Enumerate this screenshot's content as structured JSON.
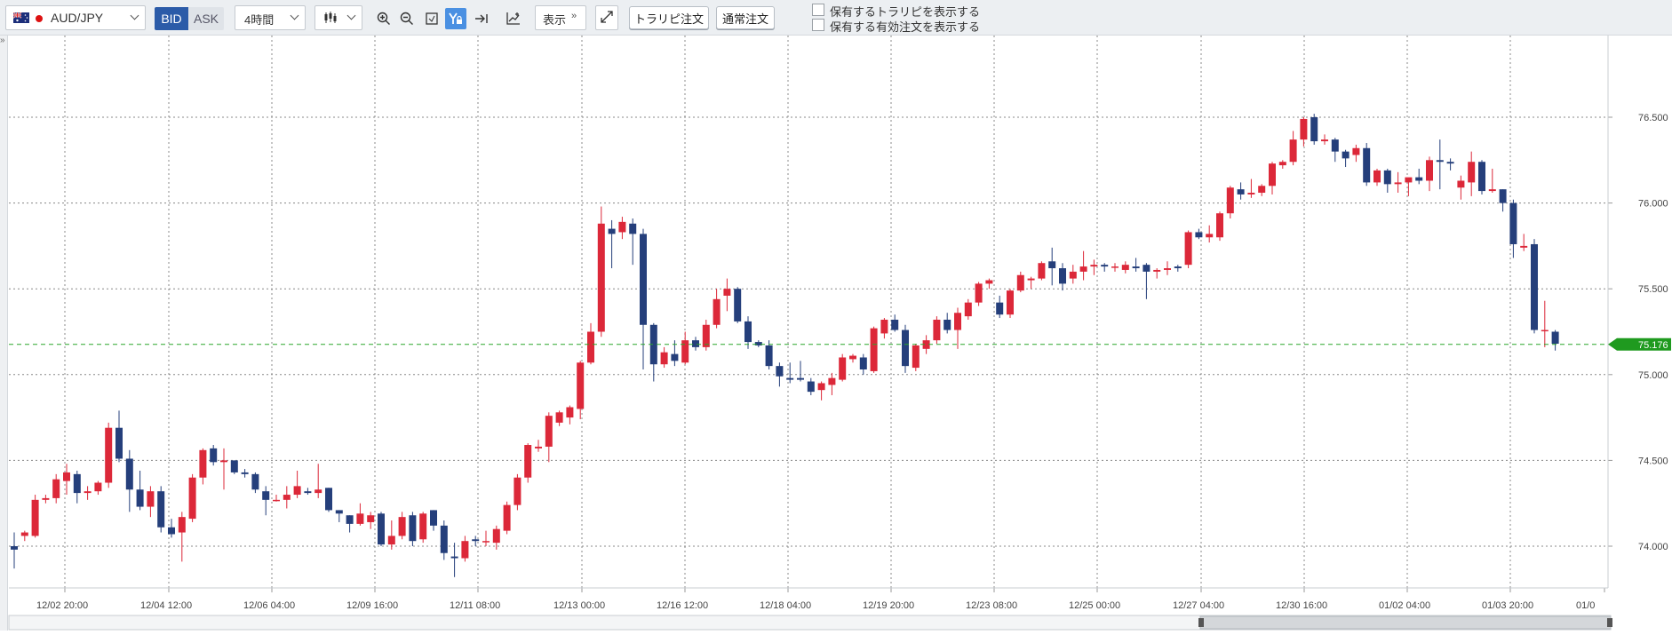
{
  "toolbar": {
    "pair": "AUD/JPY",
    "bid_label": "BID",
    "ask_label": "ASK",
    "timeframe": "4時間",
    "display_label": "表示",
    "trailing_order_label": "トラリピ注文",
    "normal_order_label": "通常注文",
    "checkbox_show_positions": "保有するトラリピを表示する",
    "checkbox_show_orders": "保有する有効注文を表示する",
    "left_expander": "»"
  },
  "chart_data": {
    "type": "candlestick",
    "symbol": "AUD/JPY",
    "interval": "4時間",
    "price": "BID",
    "colors": {
      "up": "#dc2839",
      "down": "#253f7b",
      "current_line": "#2aa52a",
      "grid": "#888888"
    },
    "ylim": [
      73.63,
      76.75
    ],
    "y_ticks": [
      "76.500",
      "76.000",
      "75.500",
      "75.000",
      "74.500",
      "74.000"
    ],
    "x_ticks": [
      "12/02 20:00",
      "12/04 12:00",
      "12/06 04:00",
      "12/09 16:00",
      "12/11 08:00",
      "12/13 00:00",
      "12/16 12:00",
      "12/18 04:00",
      "12/19 20:00",
      "12/23 08:00",
      "12/25 00:00",
      "12/27 04:00",
      "12/30 16:00",
      "01/02 04:00",
      "01/03 20:00",
      "01/0"
    ],
    "current_price": "75.176",
    "candles": [
      [
        74.0,
        74.08,
        73.87,
        73.98
      ],
      [
        74.06,
        74.09,
        74.03,
        74.08
      ],
      [
        74.06,
        74.3,
        74.05,
        74.27
      ],
      [
        74.27,
        74.3,
        74.25,
        74.28
      ],
      [
        74.28,
        74.42,
        74.25,
        74.39
      ],
      [
        74.38,
        74.48,
        74.3,
        74.43
      ],
      [
        74.42,
        74.44,
        74.25,
        74.31
      ],
      [
        74.31,
        74.35,
        74.27,
        74.32
      ],
      [
        74.32,
        74.38,
        74.3,
        74.37
      ],
      [
        74.37,
        74.72,
        74.34,
        74.69
      ],
      [
        74.69,
        74.79,
        74.49,
        74.51
      ],
      [
        74.51,
        74.56,
        74.2,
        74.33
      ],
      [
        74.33,
        74.44,
        74.21,
        74.23
      ],
      [
        74.23,
        74.35,
        74.17,
        74.32
      ],
      [
        74.32,
        74.35,
        74.08,
        74.11
      ],
      [
        74.11,
        74.16,
        74.05,
        74.07
      ],
      [
        74.08,
        74.2,
        73.91,
        74.17
      ],
      [
        74.16,
        74.42,
        74.14,
        74.4
      ],
      [
        74.4,
        74.57,
        74.36,
        74.56
      ],
      [
        74.57,
        74.59,
        74.47,
        74.49
      ],
      [
        74.49,
        74.57,
        74.33,
        74.5
      ],
      [
        74.5,
        74.5,
        74.42,
        74.43
      ],
      [
        74.43,
        74.45,
        74.4,
        74.42
      ],
      [
        74.42,
        74.43,
        74.31,
        74.33
      ],
      [
        74.32,
        74.35,
        74.18,
        74.27
      ],
      [
        74.27,
        74.3,
        74.26,
        74.27
      ],
      [
        74.27,
        74.35,
        74.22,
        74.3
      ],
      [
        74.3,
        74.44,
        74.28,
        74.35
      ],
      [
        74.32,
        74.34,
        74.3,
        74.31
      ],
      [
        74.31,
        74.48,
        74.28,
        74.33
      ],
      [
        74.34,
        74.34,
        74.2,
        74.21
      ],
      [
        74.21,
        74.21,
        74.14,
        74.19
      ],
      [
        74.18,
        74.18,
        74.08,
        74.13
      ],
      [
        74.13,
        74.25,
        74.12,
        74.19
      ],
      [
        74.14,
        74.2,
        74.1,
        74.18
      ],
      [
        74.19,
        74.2,
        74.0,
        74.01
      ],
      [
        74.01,
        74.15,
        73.98,
        74.06
      ],
      [
        74.06,
        74.2,
        74.04,
        74.17
      ],
      [
        74.18,
        74.2,
        74.0,
        74.03
      ],
      [
        74.04,
        74.2,
        74.02,
        74.19
      ],
      [
        74.21,
        74.21,
        74.09,
        74.12
      ],
      [
        74.12,
        74.15,
        73.92,
        73.96
      ],
      [
        73.94,
        74.02,
        73.82,
        73.93
      ],
      [
        73.93,
        74.06,
        73.91,
        74.03
      ],
      [
        74.04,
        74.06,
        74.0,
        74.03
      ],
      [
        74.03,
        74.09,
        74.0,
        74.03
      ],
      [
        74.02,
        74.12,
        73.98,
        74.1
      ],
      [
        74.09,
        74.26,
        74.07,
        74.24
      ],
      [
        74.24,
        74.42,
        74.21,
        74.4
      ],
      [
        74.4,
        74.6,
        74.37,
        74.59
      ],
      [
        74.57,
        74.62,
        74.55,
        74.58
      ],
      [
        74.58,
        74.78,
        74.49,
        74.76
      ],
      [
        74.72,
        74.79,
        74.7,
        74.78
      ],
      [
        74.75,
        74.82,
        74.71,
        74.81
      ],
      [
        74.8,
        75.08,
        74.74,
        75.07
      ],
      [
        75.07,
        75.3,
        75.06,
        75.25
      ],
      [
        75.25,
        75.98,
        75.22,
        75.88
      ],
      [
        75.85,
        75.9,
        75.62,
        75.82
      ],
      [
        75.83,
        75.92,
        75.79,
        75.89
      ],
      [
        75.88,
        75.91,
        75.64,
        75.82
      ],
      [
        75.82,
        75.85,
        75.03,
        75.29
      ],
      [
        75.29,
        75.3,
        74.96,
        75.06
      ],
      [
        75.06,
        75.16,
        75.04,
        75.13
      ],
      [
        75.12,
        75.2,
        75.05,
        75.08
      ],
      [
        75.07,
        75.25,
        75.06,
        75.2
      ],
      [
        75.2,
        75.22,
        75.14,
        75.16
      ],
      [
        75.16,
        75.32,
        75.14,
        75.29
      ],
      [
        75.29,
        75.5,
        75.27,
        75.44
      ],
      [
        75.46,
        75.56,
        75.37,
        75.5
      ],
      [
        75.5,
        75.51,
        75.3,
        75.31
      ],
      [
        75.31,
        75.34,
        75.15,
        75.19
      ],
      [
        75.19,
        75.2,
        75.16,
        75.17
      ],
      [
        75.17,
        75.2,
        75.03,
        75.05
      ],
      [
        75.05,
        75.07,
        74.93,
        74.99
      ],
      [
        74.98,
        75.07,
        74.95,
        74.97
      ],
      [
        74.98,
        75.08,
        74.96,
        74.97
      ],
      [
        74.96,
        74.98,
        74.88,
        74.9
      ],
      [
        74.91,
        74.96,
        74.85,
        74.95
      ],
      [
        74.94,
        75.01,
        74.88,
        74.98
      ],
      [
        74.97,
        75.12,
        74.96,
        75.1
      ],
      [
        75.09,
        75.12,
        75.07,
        75.11
      ],
      [
        75.1,
        75.12,
        75.0,
        75.03
      ],
      [
        75.02,
        75.28,
        75.01,
        75.27
      ],
      [
        75.24,
        75.33,
        75.21,
        75.32
      ],
      [
        75.32,
        75.35,
        75.25,
        75.26
      ],
      [
        75.26,
        75.29,
        75.01,
        75.05
      ],
      [
        75.04,
        75.18,
        75.02,
        75.17
      ],
      [
        75.15,
        75.23,
        75.12,
        75.2
      ],
      [
        75.2,
        75.34,
        75.18,
        75.32
      ],
      [
        75.32,
        75.36,
        75.24,
        75.26
      ],
      [
        75.26,
        75.39,
        75.15,
        75.36
      ],
      [
        75.34,
        75.44,
        75.32,
        75.42
      ],
      [
        75.42,
        75.54,
        75.4,
        75.53
      ],
      [
        75.53,
        75.56,
        75.5,
        75.55
      ],
      [
        75.42,
        75.46,
        75.33,
        75.35
      ],
      [
        75.35,
        75.5,
        75.33,
        75.49
      ],
      [
        75.49,
        75.6,
        75.48,
        75.58
      ],
      [
        75.55,
        75.57,
        75.5,
        75.56
      ],
      [
        75.56,
        75.66,
        75.55,
        75.65
      ],
      [
        75.66,
        75.74,
        75.52,
        75.62
      ],
      [
        75.62,
        75.65,
        75.49,
        75.53
      ],
      [
        75.56,
        75.64,
        75.53,
        75.6
      ],
      [
        75.6,
        75.72,
        75.55,
        75.63
      ],
      [
        75.63,
        75.67,
        75.58,
        75.64
      ],
      [
        75.64,
        75.65,
        75.6,
        75.63
      ],
      [
        75.63,
        75.65,
        75.6,
        75.63
      ],
      [
        75.61,
        75.66,
        75.59,
        75.64
      ],
      [
        75.63,
        75.68,
        75.6,
        75.62
      ],
      [
        75.64,
        75.65,
        75.44,
        75.6
      ],
      [
        75.6,
        75.62,
        75.56,
        75.61
      ],
      [
        75.61,
        75.66,
        75.58,
        75.62
      ],
      [
        75.63,
        75.64,
        75.6,
        75.62
      ],
      [
        75.64,
        75.84,
        75.62,
        75.83
      ],
      [
        75.83,
        75.85,
        75.79,
        75.8
      ],
      [
        75.8,
        75.87,
        75.77,
        75.82
      ],
      [
        75.8,
        75.95,
        75.78,
        75.94
      ],
      [
        75.94,
        76.1,
        75.91,
        76.09
      ],
      [
        76.08,
        76.12,
        76.02,
        76.05
      ],
      [
        76.05,
        76.14,
        76.03,
        76.06
      ],
      [
        76.06,
        76.11,
        76.04,
        76.1
      ],
      [
        76.1,
        76.24,
        76.05,
        76.23
      ],
      [
        76.22,
        76.25,
        76.2,
        76.24
      ],
      [
        76.24,
        76.42,
        76.22,
        76.37
      ],
      [
        76.37,
        76.5,
        76.33,
        76.49
      ],
      [
        76.5,
        76.52,
        76.34,
        76.36
      ],
      [
        76.36,
        76.4,
        76.34,
        76.37
      ],
      [
        76.37,
        76.38,
        76.24,
        76.3
      ],
      [
        76.3,
        76.31,
        76.21,
        76.26
      ],
      [
        76.28,
        76.34,
        76.24,
        76.32
      ],
      [
        76.32,
        76.35,
        76.1,
        76.12
      ],
      [
        76.12,
        76.2,
        76.1,
        76.19
      ],
      [
        76.19,
        76.2,
        76.06,
        76.11
      ],
      [
        76.11,
        76.18,
        76.06,
        76.12
      ],
      [
        76.12,
        76.14,
        76.04,
        76.15
      ],
      [
        76.15,
        76.2,
        76.11,
        76.13
      ],
      [
        76.13,
        76.27,
        76.07,
        76.25
      ],
      [
        76.25,
        76.37,
        76.08,
        76.24
      ],
      [
        76.24,
        76.26,
        76.19,
        76.23
      ],
      [
        76.09,
        76.16,
        76.02,
        76.13
      ],
      [
        76.12,
        76.3,
        76.04,
        76.24
      ],
      [
        76.24,
        76.25,
        76.05,
        76.07
      ],
      [
        76.07,
        76.2,
        76.06,
        76.08
      ],
      [
        76.08,
        76.08,
        75.95,
        76.0
      ],
      [
        76.0,
        76.02,
        75.68,
        75.76
      ],
      [
        75.74,
        75.82,
        75.72,
        75.75
      ],
      [
        75.76,
        75.79,
        75.24,
        75.26
      ],
      [
        75.26,
        75.43,
        75.16,
        75.26
      ],
      [
        75.25,
        75.26,
        75.14,
        75.18
      ]
    ]
  }
}
